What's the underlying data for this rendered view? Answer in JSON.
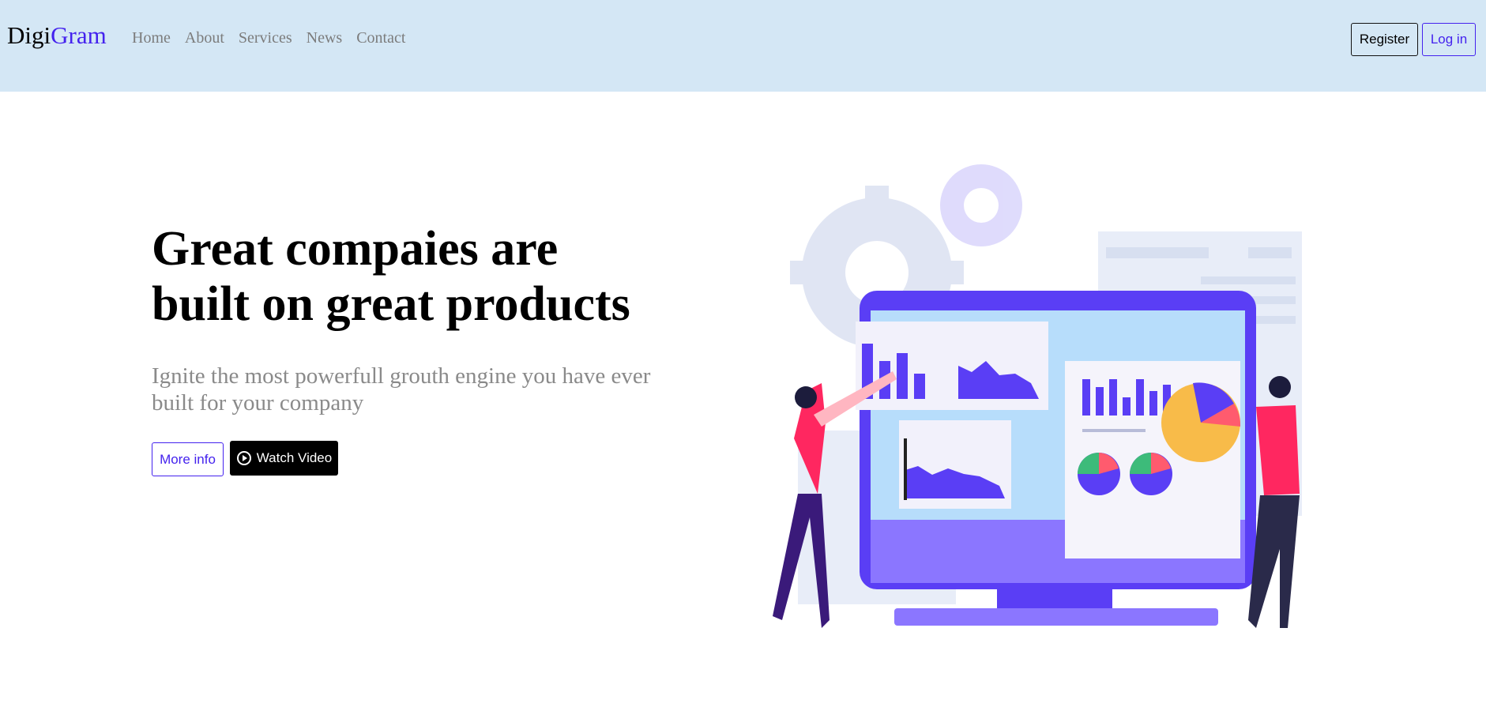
{
  "brand": {
    "part1": "Digi",
    "part2": "Gram"
  },
  "nav": {
    "items": [
      {
        "label": "Home"
      },
      {
        "label": "About"
      },
      {
        "label": "Services"
      },
      {
        "label": "News"
      },
      {
        "label": "Contact"
      }
    ]
  },
  "auth": {
    "register_label": "Register",
    "login_label": "Log in"
  },
  "hero": {
    "title_line1": "Great compaies are",
    "title_line2": "built on great products",
    "subtitle_line1": "Ignite the most powerfull grouth engine you have ever",
    "subtitle_line2": "built for your company",
    "more_info_label": "More info",
    "watch_video_label": "Watch Video"
  },
  "icons": {
    "play": "play-circle-icon",
    "illustration": "analytics-dashboard-illustration"
  },
  "colors": {
    "navbar_bg": "#d4e7f5",
    "accent": "#4422ee",
    "muted_text": "#8a8a8a",
    "illustration_primary": "#5a3ef5"
  }
}
